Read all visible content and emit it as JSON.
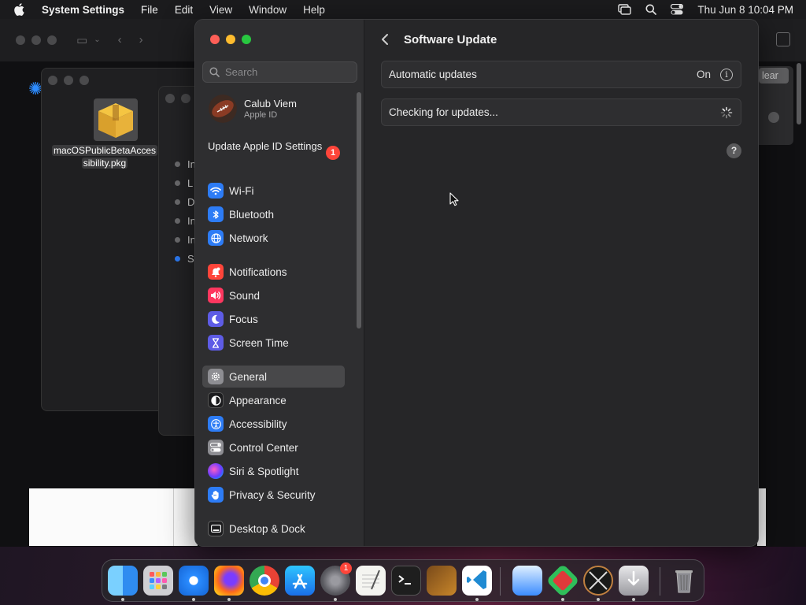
{
  "menubar": {
    "app_name": "System Settings",
    "items": [
      "File",
      "Edit",
      "View",
      "Window",
      "Help"
    ],
    "clock": "Thu Jun 8  10:04 PM"
  },
  "background": {
    "file_label_line1": "macOSPublicBetaAcces",
    "file_label_line2": "sibility.pkg",
    "list_items": [
      "In",
      "L",
      "D",
      "In",
      "In",
      "S"
    ],
    "clear_label": "lear"
  },
  "settings": {
    "search_placeholder": "Search",
    "profile": {
      "name": "Calub Viem",
      "subtitle": "Apple ID"
    },
    "update_apple_id": "Update Apple ID Settings",
    "update_badge": "1",
    "sidebar_items": [
      {
        "label": "Wi-Fi",
        "icon": "wifi-icon",
        "color": "#2d7cf6"
      },
      {
        "label": "Bluetooth",
        "icon": "bluetooth-icon",
        "color": "#2d7cf6"
      },
      {
        "label": "Network",
        "icon": "globe-icon",
        "color": "#2d7cf6"
      },
      {
        "label": "Notifications",
        "icon": "bell-icon",
        "color": "#ff453a"
      },
      {
        "label": "Sound",
        "icon": "speaker-icon",
        "color": "#ff375f"
      },
      {
        "label": "Focus",
        "icon": "moon-icon",
        "color": "#5e5ce6"
      },
      {
        "label": "Screen Time",
        "icon": "hourglass-icon",
        "color": "#5e5ce6"
      },
      {
        "label": "General",
        "icon": "gear-icon",
        "color": "#8e8e93"
      },
      {
        "label": "Appearance",
        "icon": "appearance-icon",
        "color": "#1c1c1e"
      },
      {
        "label": "Accessibility",
        "icon": "accessibility-icon",
        "color": "#2d7cf6"
      },
      {
        "label": "Control Center",
        "icon": "control-center-icon",
        "color": "#8e8e93"
      },
      {
        "label": "Siri & Spotlight",
        "icon": "siri-icon",
        "color": "#b040e0"
      },
      {
        "label": "Privacy & Security",
        "icon": "hand-icon",
        "color": "#2d7cf6"
      },
      {
        "label": "Desktop & Dock",
        "icon": "dock-icon",
        "color": "#1c1c1e"
      }
    ],
    "selected_item": "General",
    "main": {
      "title": "Software Update",
      "automatic_updates_label": "Automatic updates",
      "automatic_updates_value": "On",
      "checking_label": "Checking for updates..."
    }
  },
  "dock": {
    "apps": [
      "Finder",
      "Launchpad",
      "Safari",
      "Firefox",
      "Chrome",
      "App Store",
      "System Settings",
      "TextEdit",
      "Terminal",
      "GarageBand",
      "Visual Studio Code",
      "Remote Desktop",
      "Archiver",
      "Xcode",
      "Downloads",
      "Trash"
    ],
    "settings_badge": "1"
  },
  "colors": {
    "accent": "#2d7cf6",
    "badge": "#ff453a",
    "sidebar_bg": "#2e2e30",
    "content_bg": "#262628"
  }
}
